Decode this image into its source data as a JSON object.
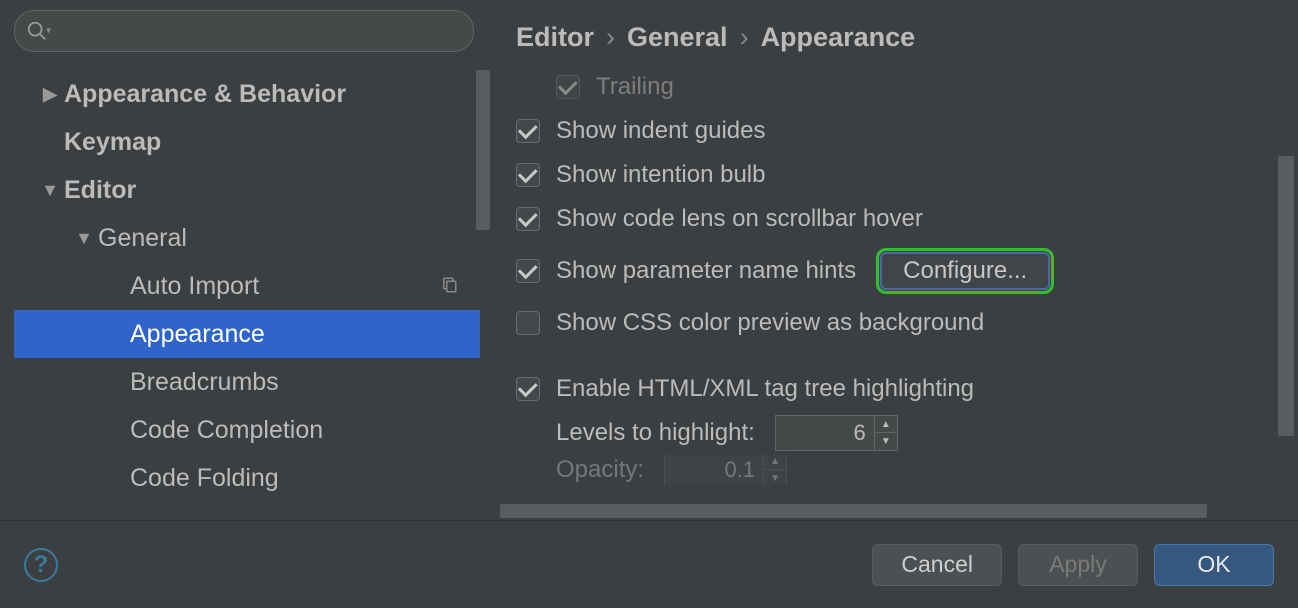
{
  "search": {
    "placeholder": ""
  },
  "sidebar": {
    "items": [
      {
        "label": "Appearance & Behavior",
        "expandable": true,
        "expanded": false
      },
      {
        "label": "Keymap"
      },
      {
        "label": "Editor",
        "expandable": true,
        "expanded": true
      },
      {
        "label": "General",
        "expandable": true,
        "expanded": true
      },
      {
        "label": "Auto Import"
      },
      {
        "label": "Appearance",
        "selected": true
      },
      {
        "label": "Breadcrumbs"
      },
      {
        "label": "Code Completion"
      },
      {
        "label": "Code Folding"
      }
    ]
  },
  "breadcrumb": {
    "a": "Editor",
    "b": "General",
    "c": "Appearance"
  },
  "settings": {
    "trailing": "Trailing",
    "indent": "Show indent guides",
    "intention": "Show intention bulb",
    "codelens": "Show code lens on scrollbar hover",
    "paramhints": "Show parameter name hints",
    "configure": "Configure...",
    "csscolor": "Show CSS color preview as background",
    "tagtree": "Enable HTML/XML tag tree highlighting",
    "levels_label": "Levels to highlight:",
    "levels_value": "6",
    "opacity_label": "Opacity:",
    "opacity_value": "0.1"
  },
  "footer": {
    "cancel": "Cancel",
    "apply": "Apply",
    "ok": "OK"
  }
}
